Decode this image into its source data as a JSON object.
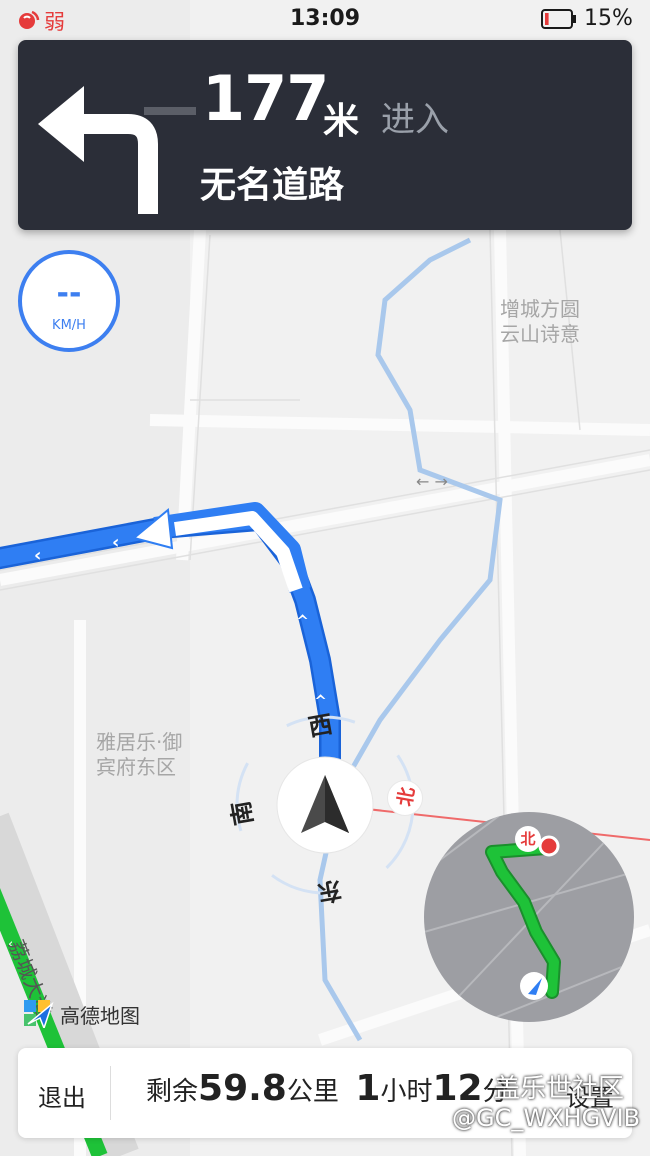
{
  "status_bar": {
    "signal": "弱",
    "time": "13:09",
    "battery_percent": "15%",
    "battery_level": 0.15
  },
  "guidance": {
    "turn_icon": "turn-left-arrow-icon",
    "distance": "177",
    "distance_unit": "米",
    "action": "进入",
    "road_name": "无名道路"
  },
  "speed": {
    "value": "--",
    "unit": "KM/H"
  },
  "map": {
    "poi_1": [
      "增城方圆",
      "云山诗意"
    ],
    "poi_2": [
      "雅居乐·御",
      "宾府东区"
    ],
    "compass": {
      "west": "西",
      "south": "南",
      "east": "东",
      "north": "北"
    },
    "road_label": "荔城大道",
    "overview_north": "北"
  },
  "brand": {
    "logo_text": "高德地图"
  },
  "bottom_bar": {
    "exit": "退出",
    "remain_label": "剩余",
    "remain_distance": "59.8",
    "remain_distance_unit": "公里",
    "remain_hours": "1",
    "remain_hours_unit": "小时",
    "remain_minutes": "12",
    "remain_minutes_unit": "分",
    "settings": "设置"
  },
  "watermark": {
    "line1": "盖乐世社区",
    "line2": "@GC_WXHGVIB"
  },
  "colors": {
    "route_blue": "#2f7ef3",
    "route_green": "#1ec238",
    "card_dark": "#2b2e38",
    "accent_red": "#e53b3b"
  }
}
